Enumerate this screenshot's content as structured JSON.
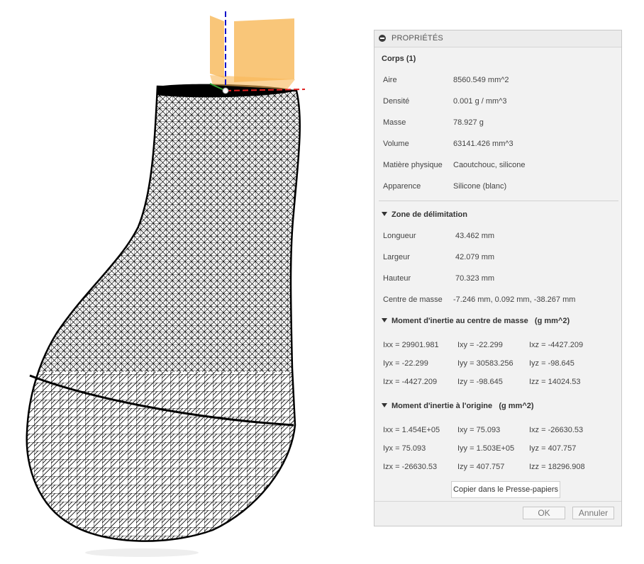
{
  "panel": {
    "header_title": "PROPRIÉTÉS",
    "body_title": "Corps (1)",
    "properties": [
      {
        "label": "Aire",
        "value": "8560.549 mm^2"
      },
      {
        "label": "Densité",
        "value": "0.001 g / mm^3"
      },
      {
        "label": "Masse",
        "value": "78.927 g"
      },
      {
        "label": "Volume",
        "value": "63141.426 mm^3"
      },
      {
        "label": "Matière physique",
        "value": "Caoutchouc, silicone"
      },
      {
        "label": "Apparence",
        "value": "Silicone (blanc)"
      }
    ],
    "bbox_section": {
      "title": "Zone de délimitation",
      "rows": [
        {
          "label": "Longueur",
          "value": "43.462 mm"
        },
        {
          "label": "Largeur",
          "value": "42.079 mm"
        },
        {
          "label": "Hauteur",
          "value": "70.323 mm"
        },
        {
          "label": "Centre de masse",
          "value": "-7.246 mm, 0.092 mm, -38.267 mm"
        }
      ]
    },
    "inertia_center": {
      "title": "Moment d'inertie au centre de masse",
      "units": "(g mm^2)",
      "rows": [
        [
          "Ixx = 29901.981",
          "Ixy = -22.299",
          "Ixz = -4427.209"
        ],
        [
          "Iyx = -22.299",
          "Iyy = 30583.256",
          "Iyz = -98.645"
        ],
        [
          "Izx = -4427.209",
          "Izy = -98.645",
          "Izz = 14024.53"
        ]
      ]
    },
    "inertia_origin": {
      "title": "Moment d'inertie à l'origine",
      "units": "(g mm^2)",
      "rows": [
        [
          "Ixx = 1.454E+05",
          "Ixy = 75.093",
          "Ixz = -26630.53"
        ],
        [
          "Iyx = 75.093",
          "Iyy = 1.503E+05",
          "Iyz = 407.757"
        ],
        [
          "Izx = -26630.53",
          "Izy = 407.757",
          "Izz = 18296.908"
        ]
      ]
    },
    "copy_button": "Copier dans le Presse-papiers",
    "ok_button": "OK",
    "cancel_button": "Annuler"
  },
  "colors": {
    "mesh": "#000000",
    "plane": "#f8b858",
    "axis_x": "#e02020",
    "axis_y": "#1010c8",
    "axis_z": "#30a030"
  }
}
